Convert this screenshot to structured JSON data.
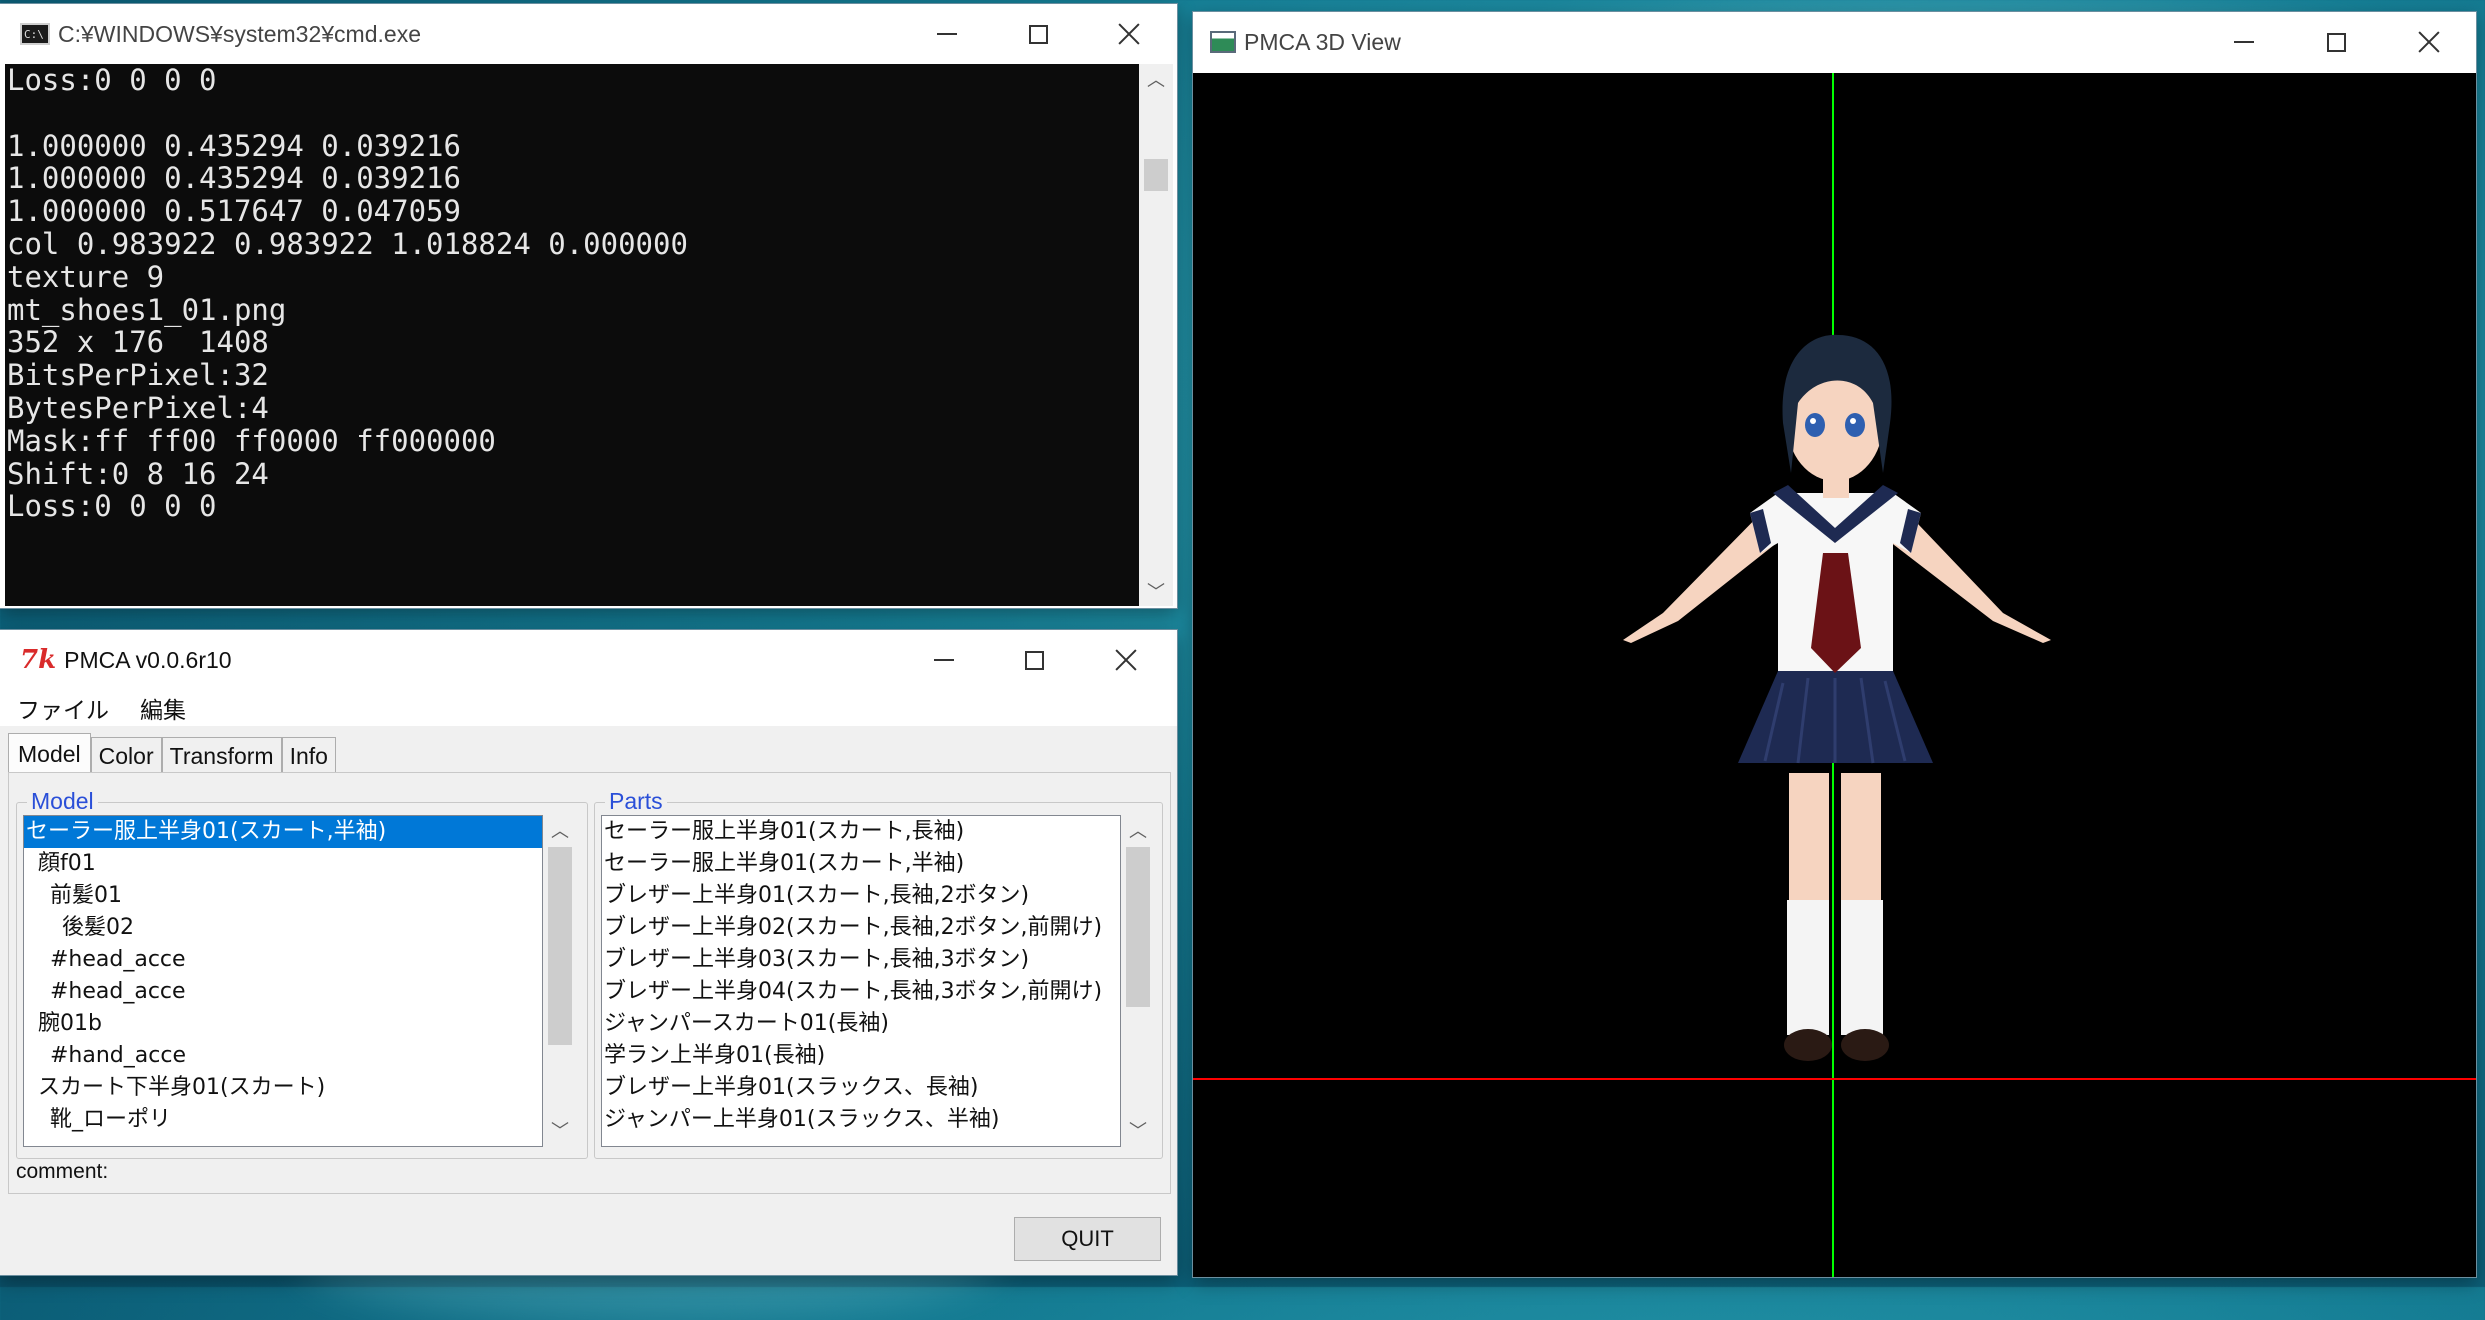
{
  "cmd": {
    "title": "C:¥WINDOWS¥system32¥cmd.exe",
    "icon": "cmd-console-icon",
    "output_lines": [
      "Loss:0 0 0 0",
      "",
      "1.000000 0.435294 0.039216",
      "1.000000 0.435294 0.039216",
      "1.000000 0.517647 0.047059",
      "col 0.983922 0.983922 1.018824 0.000000",
      "texture 9",
      "mt_shoes1_01.png",
      "352 x 176  1408",
      "BitsPerPixel:32",
      "BytesPerPixel:4",
      "Mask:ff ff00 ff0000 ff000000",
      "Shift:0 8 16 24",
      "Loss:0 0 0 0"
    ]
  },
  "pmca": {
    "title": "PMCA v0.0.6r10",
    "icon": "tk-feather-icon",
    "menu": [
      "ファイル",
      "編集"
    ],
    "tabs": [
      "Model",
      "Color",
      "Transform",
      "Info"
    ],
    "active_tab": "Model",
    "model_group_label": "Model",
    "model_items": [
      "セーラー服上半身01(スカート,半袖)",
      "  顔f01",
      "    前髪01",
      "      後髪02",
      "    #head_acce",
      "    #head_acce",
      "  腕01b",
      "    #hand_acce",
      "  スカート下半身01(スカート)",
      "    靴_ローポリ"
    ],
    "model_selected_index": 0,
    "parts_group_label": "Parts",
    "parts_items": [
      "セーラー服上半身01(スカート,長袖)",
      "セーラー服上半身01(スカート,半袖)",
      "ブレザー上半身01(スカート,長袖,2ボタン)",
      "ブレザー上半身02(スカート,長袖,2ボタン,前開け)",
      "ブレザー上半身03(スカート,長袖,3ボタン)",
      "ブレザー上半身04(スカート,長袖,3ボタン,前開け)",
      "ジャンパースカート01(長袖)",
      "学ラン上半身01(長袖)",
      "ブレザー上半身01(スラックス、長袖)",
      "ジャンパー上半身01(スラックス、半袖)"
    ],
    "comment_label": "comment:",
    "quit_label": "QUIT"
  },
  "view3d": {
    "title": "PMCA 3D View",
    "icon": "window-app-icon",
    "colors": {
      "background": "#000000",
      "y_axis": "#00ff00",
      "x_axis": "#ff0000"
    }
  },
  "window_controls": {
    "minimize": "minimize-icon",
    "maximize": "maximize-icon",
    "close": "close-icon"
  }
}
